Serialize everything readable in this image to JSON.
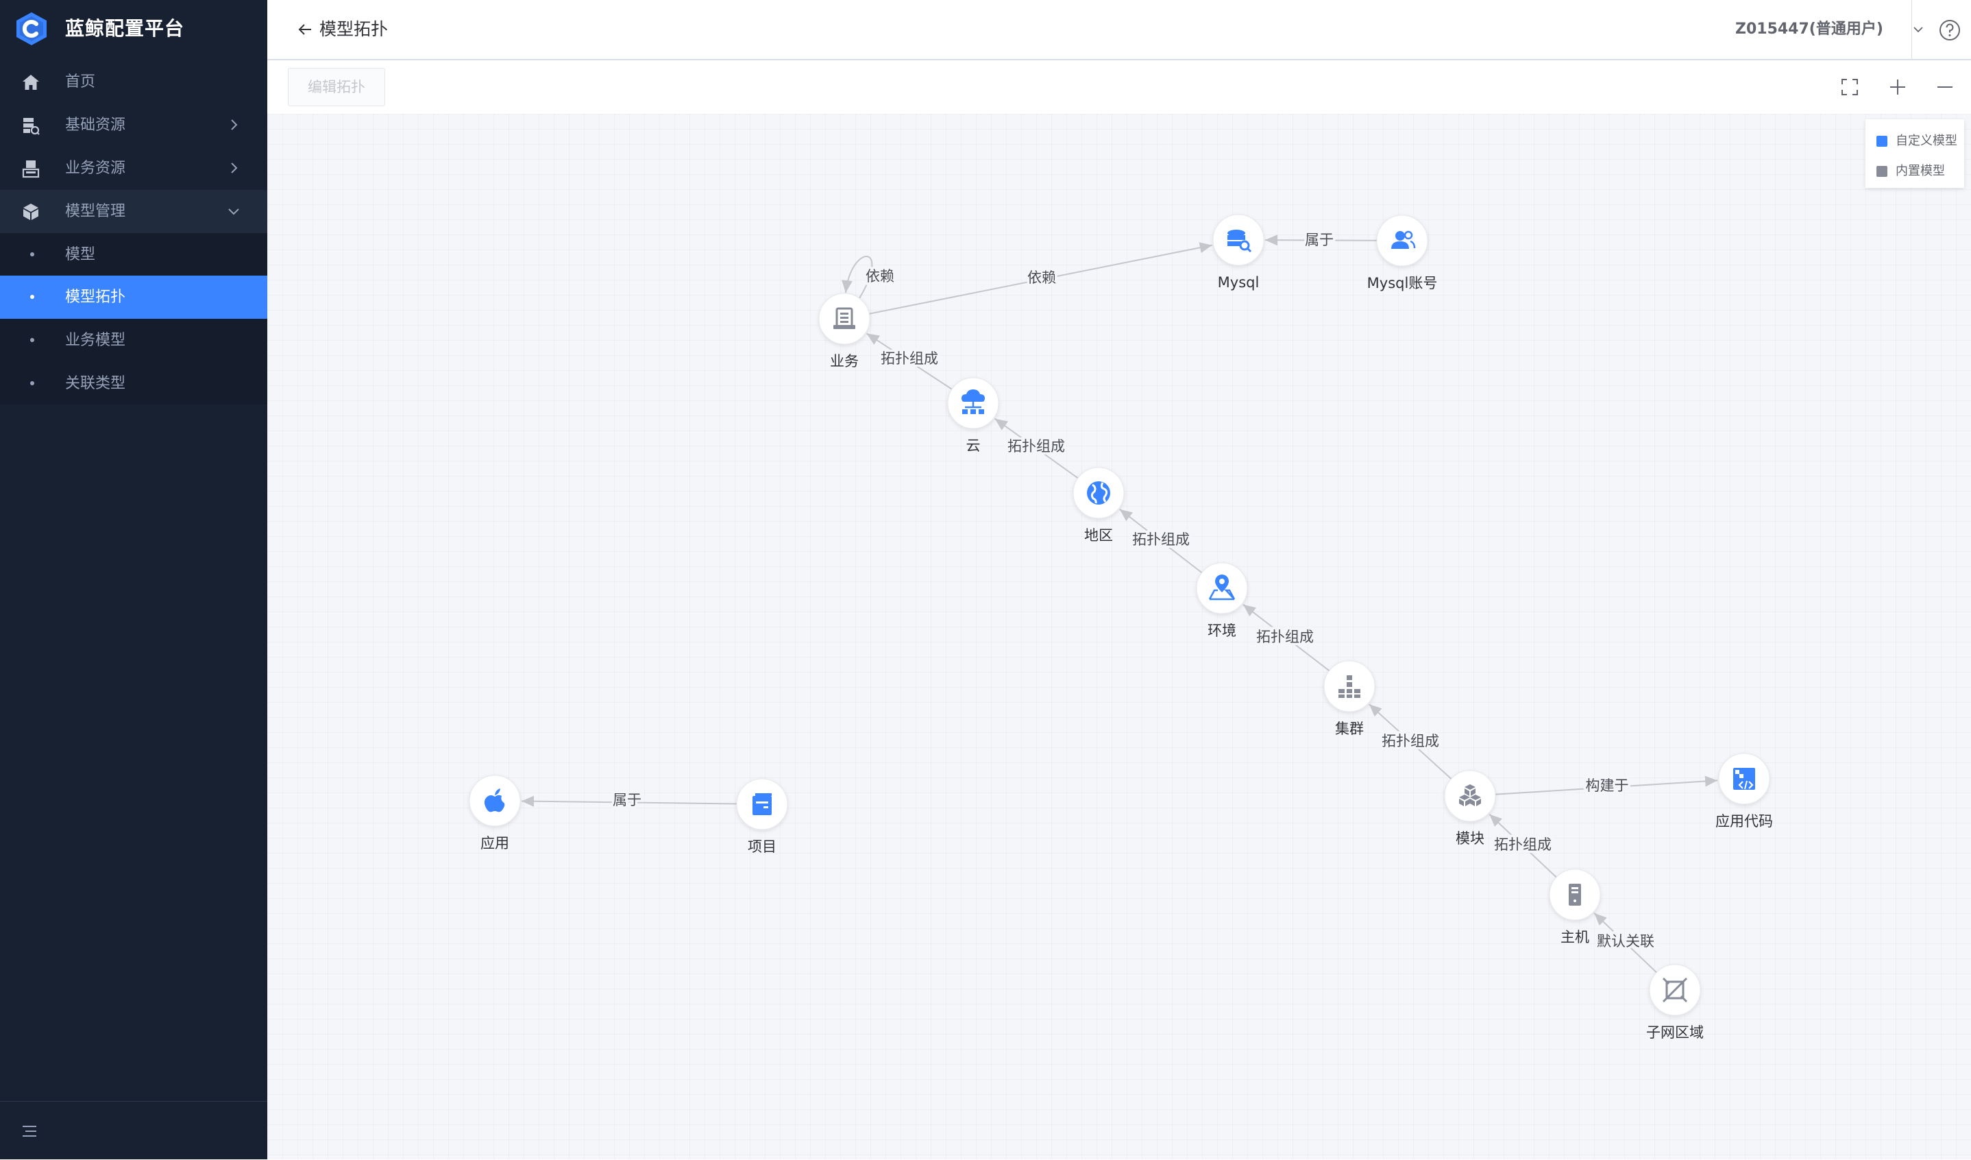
{
  "app": {
    "title": "蓝鲸配置平台"
  },
  "sidebar": {
    "items": [
      {
        "label": "首页",
        "icon": "home-icon"
      },
      {
        "label": "基础资源",
        "icon": "database-icon"
      },
      {
        "label": "业务资源",
        "icon": "business-icon"
      },
      {
        "label": "模型管理",
        "icon": "cube-icon",
        "expanded": true
      },
      {
        "label": "模型"
      },
      {
        "label": "模型拓扑",
        "active": true
      },
      {
        "label": "业务模型"
      },
      {
        "label": "关联类型"
      }
    ]
  },
  "header": {
    "back_label": "模型拓扑",
    "user": "Z015447(普通用户)"
  },
  "toolbar": {
    "edit_label": "编辑拓扑"
  },
  "legend": [
    {
      "label": "自定义模型",
      "color": "#3a84ff"
    },
    {
      "label": "内置模型",
      "color": "#868b97"
    }
  ],
  "colors": {
    "custom": "#3a84ff",
    "builtin": "#868b97",
    "edge": "#c4c6cc",
    "sidebar_bg": "#182132",
    "active": "#3a84ff"
  },
  "graph": {
    "nodes": [
      {
        "id": "biz",
        "label": "业务",
        "type": "builtin",
        "icon": "business-doc-icon"
      },
      {
        "id": "mysql",
        "label": "Mysql",
        "type": "custom",
        "icon": "database-search-icon"
      },
      {
        "id": "mysqlacc",
        "label": "Mysql账号",
        "type": "custom",
        "icon": "user-group-icon"
      },
      {
        "id": "cloud",
        "label": "云",
        "type": "custom",
        "icon": "cloud-network-icon"
      },
      {
        "id": "region",
        "label": "地区",
        "type": "custom",
        "icon": "globe-icon"
      },
      {
        "id": "env",
        "label": "环境",
        "type": "custom",
        "icon": "map-pin-icon"
      },
      {
        "id": "cluster",
        "label": "集群",
        "type": "builtin",
        "icon": "cluster-icon"
      },
      {
        "id": "module",
        "label": "模块",
        "type": "builtin",
        "icon": "module-cubes-icon"
      },
      {
        "id": "appcode",
        "label": "应用代码",
        "type": "custom",
        "icon": "code-icon"
      },
      {
        "id": "host",
        "label": "主机",
        "type": "builtin",
        "icon": "server-icon"
      },
      {
        "id": "subnet",
        "label": "子网区域",
        "type": "builtin",
        "icon": "subnet-icon"
      },
      {
        "id": "app",
        "label": "应用",
        "type": "custom",
        "icon": "apple-icon"
      },
      {
        "id": "project",
        "label": "项目",
        "type": "custom",
        "icon": "project-icon"
      }
    ],
    "edges": [
      {
        "from": "biz",
        "to": "biz",
        "label": "依赖"
      },
      {
        "from": "biz",
        "to": "mysql",
        "label": "依赖"
      },
      {
        "from": "mysqlacc",
        "to": "mysql",
        "label": "属于"
      },
      {
        "from": "cloud",
        "to": "biz",
        "label": "拓扑组成"
      },
      {
        "from": "region",
        "to": "cloud",
        "label": "拓扑组成"
      },
      {
        "from": "env",
        "to": "region",
        "label": "拓扑组成"
      },
      {
        "from": "cluster",
        "to": "env",
        "label": "拓扑组成"
      },
      {
        "from": "module",
        "to": "cluster",
        "label": "拓扑组成"
      },
      {
        "from": "module",
        "to": "appcode",
        "label": "构建于"
      },
      {
        "from": "host",
        "to": "module",
        "label": "拓扑组成"
      },
      {
        "from": "subnet",
        "to": "host",
        "label": "默认关联"
      },
      {
        "from": "project",
        "to": "app",
        "label": "属于"
      }
    ]
  }
}
